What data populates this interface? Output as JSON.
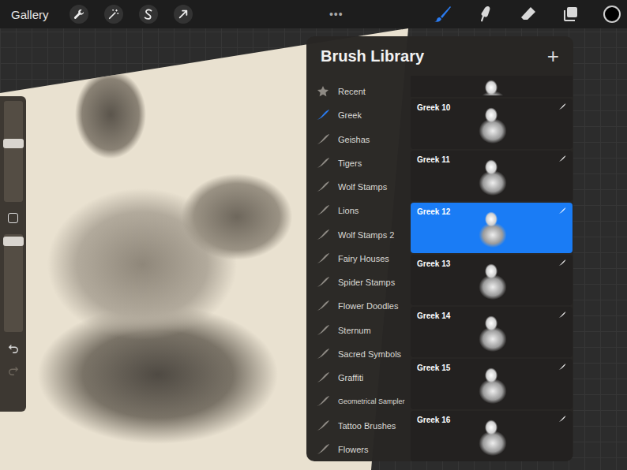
{
  "toolbar": {
    "gallery": "Gallery",
    "more": "•••",
    "actions": [
      {
        "kind": "wrench"
      },
      {
        "kind": "wand"
      },
      {
        "kind": "selection"
      },
      {
        "kind": "transform"
      }
    ],
    "tools": [
      {
        "kind": "brush",
        "selected": true
      },
      {
        "kind": "smudge",
        "selected": false
      },
      {
        "kind": "eraser",
        "selected": false
      },
      {
        "kind": "layers",
        "selected": false
      }
    ],
    "color_swatch": {
      "color": "#000000"
    }
  },
  "sidebar": {
    "size_level": 0.58,
    "opacity_level": 0.93,
    "redo_disabled": true
  },
  "brush_library": {
    "title": "Brush Library",
    "add": "+",
    "categories": [
      {
        "label": "Recent",
        "kind": "recent",
        "selected": false
      },
      {
        "label": "Greek",
        "kind": "set",
        "selected": true
      },
      {
        "label": "Geishas",
        "kind": "set",
        "selected": false
      },
      {
        "label": "Tigers",
        "kind": "set",
        "selected": false
      },
      {
        "label": "Wolf Stamps",
        "kind": "set",
        "selected": false
      },
      {
        "label": "Lions",
        "kind": "set",
        "selected": false
      },
      {
        "label": "Wolf Stamps 2",
        "kind": "set",
        "selected": false
      },
      {
        "label": "Fairy Houses",
        "kind": "set",
        "selected": false
      },
      {
        "label": "Spider Stamps",
        "kind": "set",
        "selected": false
      },
      {
        "label": "Flower Doodles",
        "kind": "set",
        "selected": false
      },
      {
        "label": "Sternum",
        "kind": "set",
        "selected": false
      },
      {
        "label": "Sacred Symbols",
        "kind": "set",
        "selected": false
      },
      {
        "label": "Graffiti",
        "kind": "set",
        "selected": false
      },
      {
        "label": "Geometrical Sampler",
        "kind": "set",
        "selected": false
      },
      {
        "label": "Tattoo Brushes",
        "kind": "set",
        "selected": false
      },
      {
        "label": "Flowers",
        "kind": "set",
        "selected": false
      }
    ],
    "brushes": [
      {
        "name": "Greek 10",
        "selected": false
      },
      {
        "name": "Greek 11",
        "selected": false
      },
      {
        "name": "Greek 12",
        "selected": true
      },
      {
        "name": "Greek 13",
        "selected": false
      },
      {
        "name": "Greek 14",
        "selected": false
      },
      {
        "name": "Greek 15",
        "selected": false
      },
      {
        "name": "Greek 16",
        "selected": false
      }
    ]
  }
}
